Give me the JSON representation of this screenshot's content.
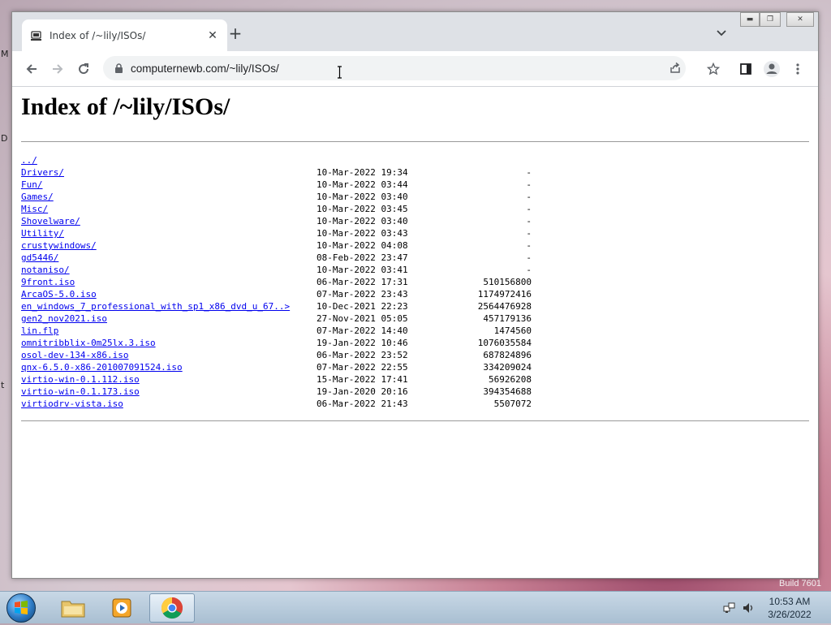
{
  "desktop": {
    "build_text": "Build 7601",
    "edge_labels": [
      "M",
      "D",
      "t"
    ]
  },
  "browser": {
    "tab_title": "Index of /~lily/ISOs/",
    "url": "computernewb.com/~lily/ISOs/"
  },
  "page": {
    "heading": "Index of /~lily/ISOs/",
    "entries": [
      {
        "name": "../",
        "date": "",
        "size": ""
      },
      {
        "name": "Drivers/",
        "date": "10-Mar-2022 19:34",
        "size": "-"
      },
      {
        "name": "Fun/",
        "date": "10-Mar-2022 03:44",
        "size": "-"
      },
      {
        "name": "Games/",
        "date": "10-Mar-2022 03:40",
        "size": "-"
      },
      {
        "name": "Misc/",
        "date": "10-Mar-2022 03:45",
        "size": "-"
      },
      {
        "name": "Shovelware/",
        "date": "10-Mar-2022 03:40",
        "size": "-"
      },
      {
        "name": "Utility/",
        "date": "10-Mar-2022 03:43",
        "size": "-"
      },
      {
        "name": "crustywindows/",
        "date": "10-Mar-2022 04:08",
        "size": "-"
      },
      {
        "name": "gd5446/",
        "date": "08-Feb-2022 23:47",
        "size": "-"
      },
      {
        "name": "notaniso/",
        "date": "10-Mar-2022 03:41",
        "size": "-"
      },
      {
        "name": "9front.iso",
        "date": "06-Mar-2022 17:31",
        "size": "510156800"
      },
      {
        "name": "ArcaOS-5.0.iso",
        "date": "07-Mar-2022 23:43",
        "size": "1174972416"
      },
      {
        "name": "en_windows_7_professional_with_sp1_x86_dvd_u_67..>",
        "date": "10-Dec-2021 22:23",
        "size": "2564476928"
      },
      {
        "name": "gen2_nov2021.iso",
        "date": "27-Nov-2021 05:05",
        "size": "457179136"
      },
      {
        "name": "lin.flp",
        "date": "07-Mar-2022 14:40",
        "size": "1474560"
      },
      {
        "name": "omnitribblix-0m25lx.3.iso",
        "date": "19-Jan-2022 10:46",
        "size": "1076035584"
      },
      {
        "name": "osol-dev-134-x86.iso",
        "date": "06-Mar-2022 23:52",
        "size": "687824896"
      },
      {
        "name": "qnx-6.5.0-x86-201007091524.iso",
        "date": "07-Mar-2022 22:55",
        "size": "334209024"
      },
      {
        "name": "virtio-win-0.1.112.iso",
        "date": "15-Mar-2022 17:41",
        "size": "56926208"
      },
      {
        "name": "virtio-win-0.1.173.iso",
        "date": "19-Jan-2020 20:16",
        "size": "394354688"
      },
      {
        "name": "virtiodrv-vista.iso",
        "date": "06-Mar-2022 21:43",
        "size": "5507072"
      }
    ]
  },
  "taskbar": {
    "time": "10:53 AM",
    "date": "3/26/2022"
  },
  "colors": {
    "link": "#0000ee",
    "chrome_frame": "#dee1e6",
    "taskbar": "#b9cde0"
  },
  "icons": [
    "browser-favicon-icon",
    "close-tab-icon",
    "plus-icon",
    "chevron-down-icon",
    "back-arrow-icon",
    "forward-arrow-icon",
    "reload-icon",
    "lock-icon",
    "share-icon",
    "star-icon",
    "side-panel-icon",
    "profile-icon",
    "kebab-menu-icon",
    "windows-start-icon",
    "folder-icon",
    "media-player-icon",
    "chrome-icon",
    "network-icon",
    "volume-icon"
  ]
}
